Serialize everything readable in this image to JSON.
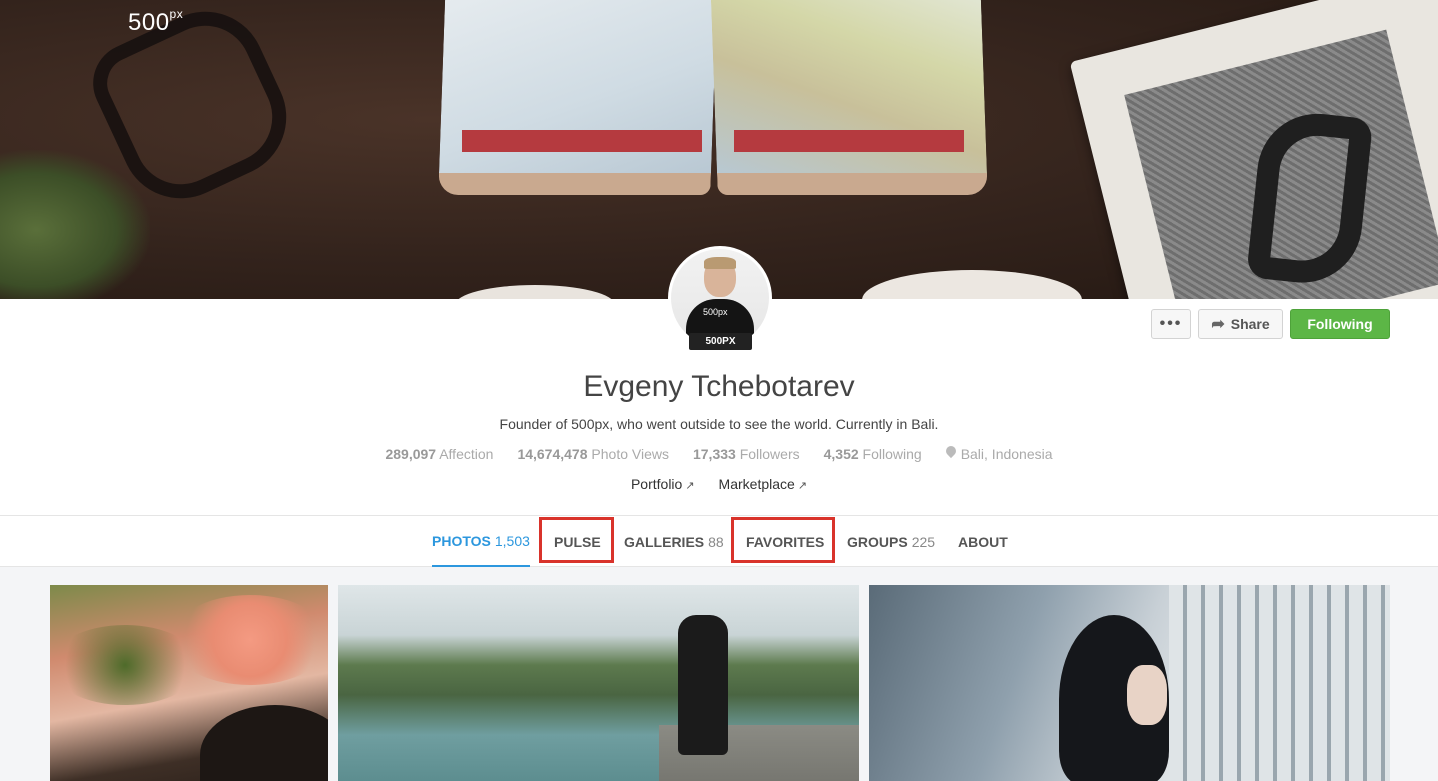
{
  "brand": {
    "logo": "500",
    "logo_sup": "px"
  },
  "profile": {
    "avatar_badge": "500PX",
    "avatar_shirt_text": "500px",
    "name": "Evgeny Tchebotarev",
    "bio": "Founder of 500px, who went outside to see the world. Currently in Bali.",
    "stats": [
      {
        "value": "289,097",
        "label": "Affection"
      },
      {
        "value": "14,674,478",
        "label": "Photo Views"
      },
      {
        "value": "17,333",
        "label": "Followers"
      },
      {
        "value": "4,352",
        "label": "Following"
      }
    ],
    "location": "Bali, Indonesia",
    "links": [
      {
        "label": "Portfolio"
      },
      {
        "label": "Marketplace"
      }
    ]
  },
  "actions": {
    "more_label": "•••",
    "share_label": "Share",
    "follow_label": "Following",
    "follow_color": "#5cb646"
  },
  "tabs": [
    {
      "label": "PHOTOS",
      "count": "1,503",
      "active": true
    },
    {
      "label": "PULSE",
      "count": "",
      "highlighted": true
    },
    {
      "label": "GALLERIES",
      "count": "88"
    },
    {
      "label": "FAVORITES",
      "count": "",
      "highlighted": true
    },
    {
      "label": "GROUPS",
      "count": "225"
    },
    {
      "label": "ABOUT",
      "count": ""
    }
  ],
  "colors": {
    "accent": "#2c97de",
    "highlight": "#d9332b"
  },
  "icons": {
    "share": "share-arrow-icon",
    "location": "map-pin-icon",
    "external": "external-link-icon"
  }
}
